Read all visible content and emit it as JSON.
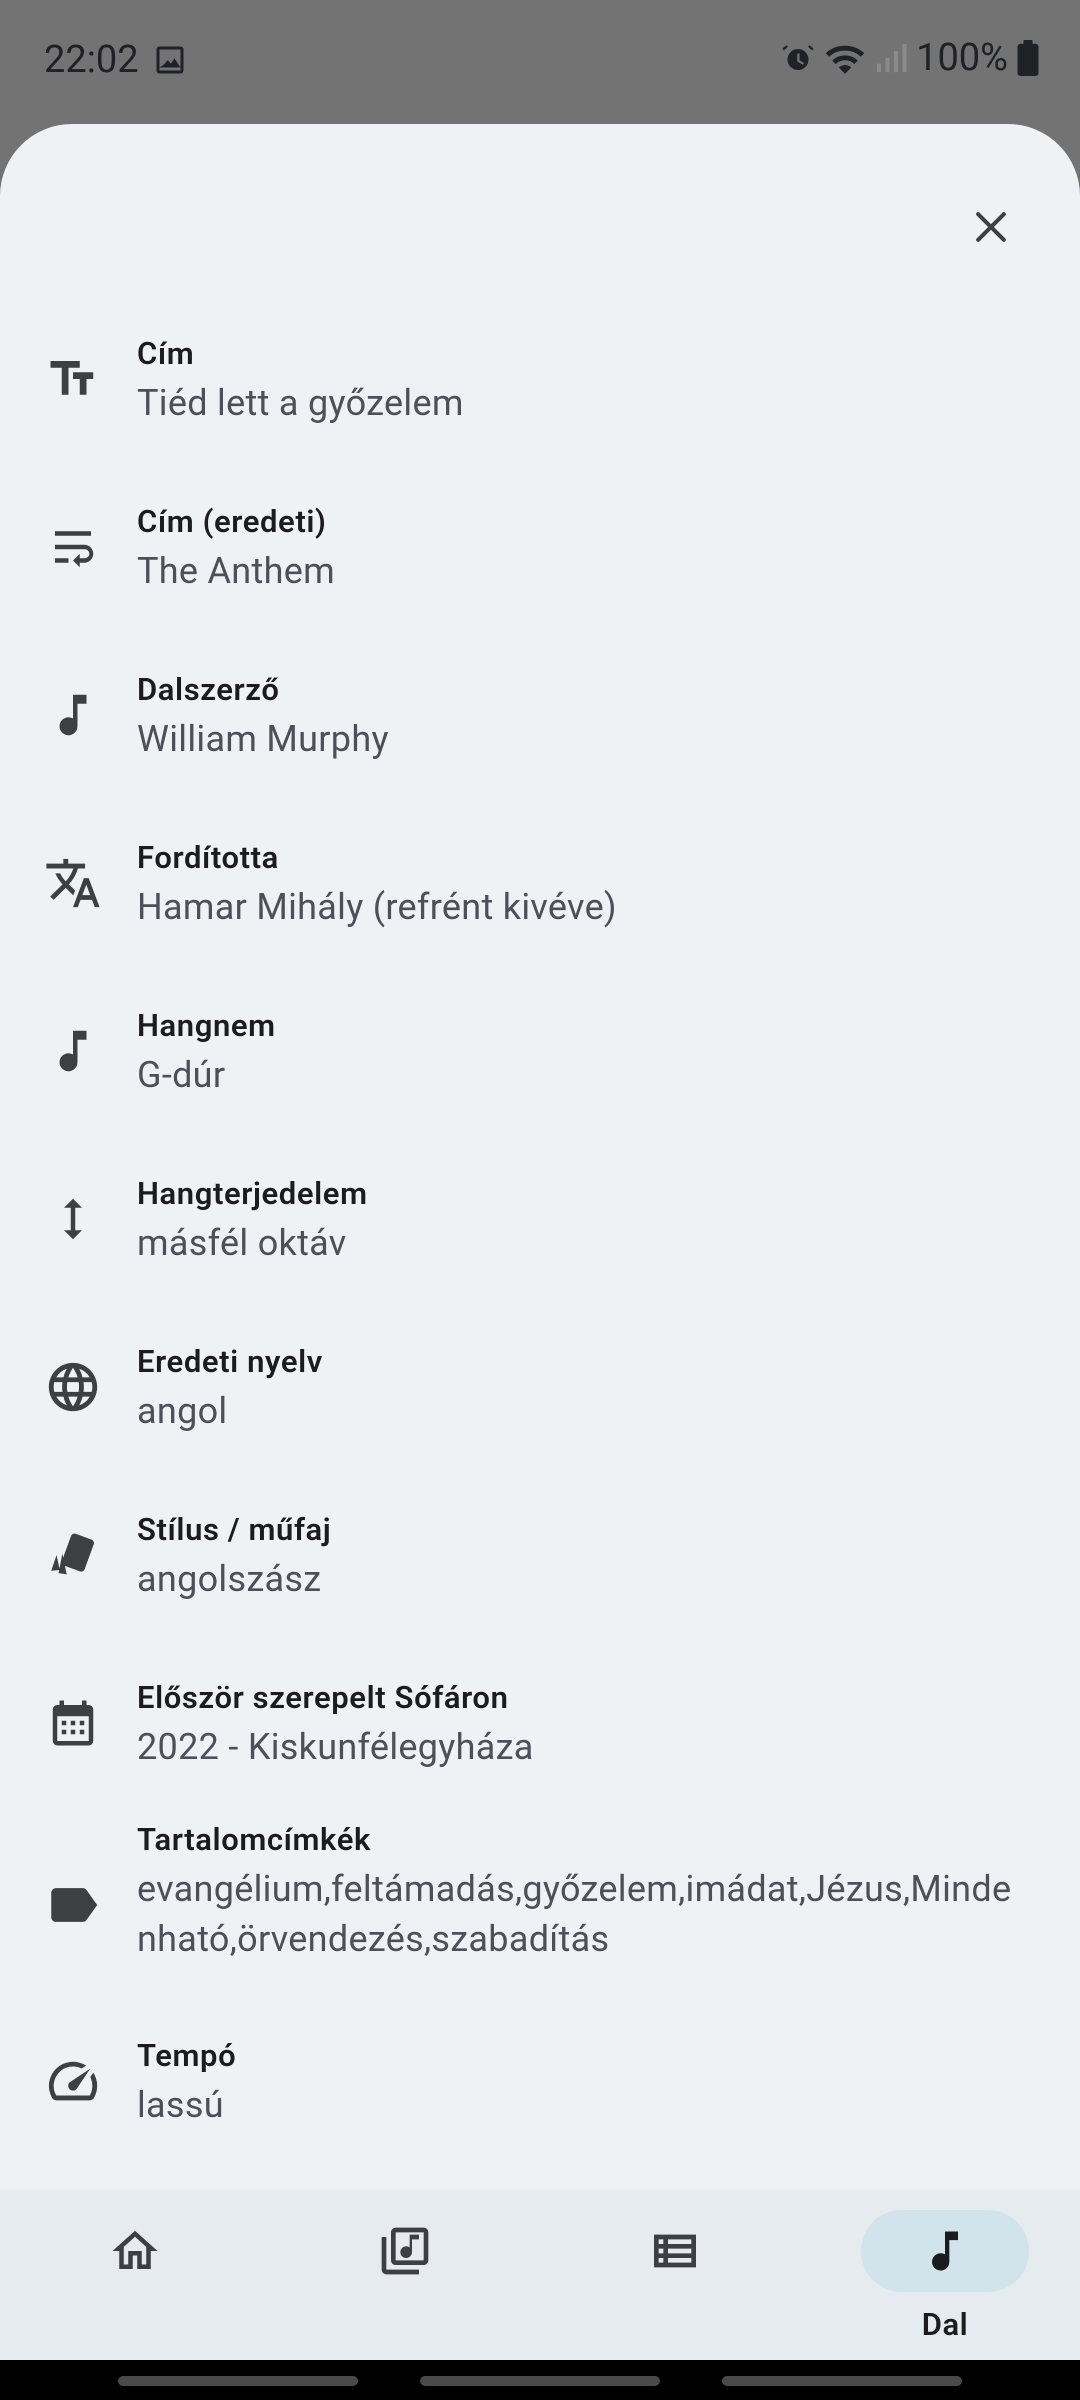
{
  "status_bar": {
    "time": "22:02",
    "battery": "100%",
    "icons": [
      "image-icon",
      "alarm-icon",
      "wifi-icon",
      "signal-icon",
      "battery-icon"
    ]
  },
  "sheet": {
    "close_icon": "close-icon",
    "rows": [
      {
        "icon": "text-size-icon",
        "label": "Cím",
        "value": "Tiéd lett a győzelem"
      },
      {
        "icon": "wrap-text-icon",
        "label": "Cím (eredeti)",
        "value": "The Anthem"
      },
      {
        "icon": "music-note-icon",
        "label": "Dalszerző",
        "value": "William Murphy"
      },
      {
        "icon": "translate-icon",
        "label": "Fordította",
        "value": "Hamar Mihály (refrént kivéve)"
      },
      {
        "icon": "music-note-icon",
        "label": "Hangnem",
        "value": "G-dúr"
      },
      {
        "icon": "vertical-arrows-icon",
        "label": "Hangterjedelem",
        "value": "másfél oktáv"
      },
      {
        "icon": "globe-icon",
        "label": "Eredeti nyelv",
        "value": "angol"
      },
      {
        "icon": "style-cards-icon",
        "label": "Stílus / műfaj",
        "value": "angolszász"
      },
      {
        "icon": "calendar-icon",
        "label": "Először szerepelt Sófáron",
        "value": "2022 - Kiskunfélegyháza"
      },
      {
        "icon": "label-tag-icon",
        "label": "Tartalomcímkék",
        "value": "evangélium,feltámadás,győzelem,imádat,Jézus,Mindenható,örvendezés,szabadítás"
      },
      {
        "icon": "speedometer-icon",
        "label": "Tempó",
        "value": "lassú"
      }
    ]
  },
  "nav": {
    "items": [
      {
        "icon": "home-icon",
        "label": ""
      },
      {
        "icon": "music-library-icon",
        "label": ""
      },
      {
        "icon": "list-icon",
        "label": ""
      },
      {
        "icon": "music-note-icon",
        "label": "Dal",
        "active": true
      }
    ]
  },
  "colors": {
    "sheet_bg": "#eff2f5",
    "nav_bg": "#e6ebef",
    "active_pill": "#d1e3eb",
    "icon": "#3c4043",
    "status_bg": "#737373"
  }
}
